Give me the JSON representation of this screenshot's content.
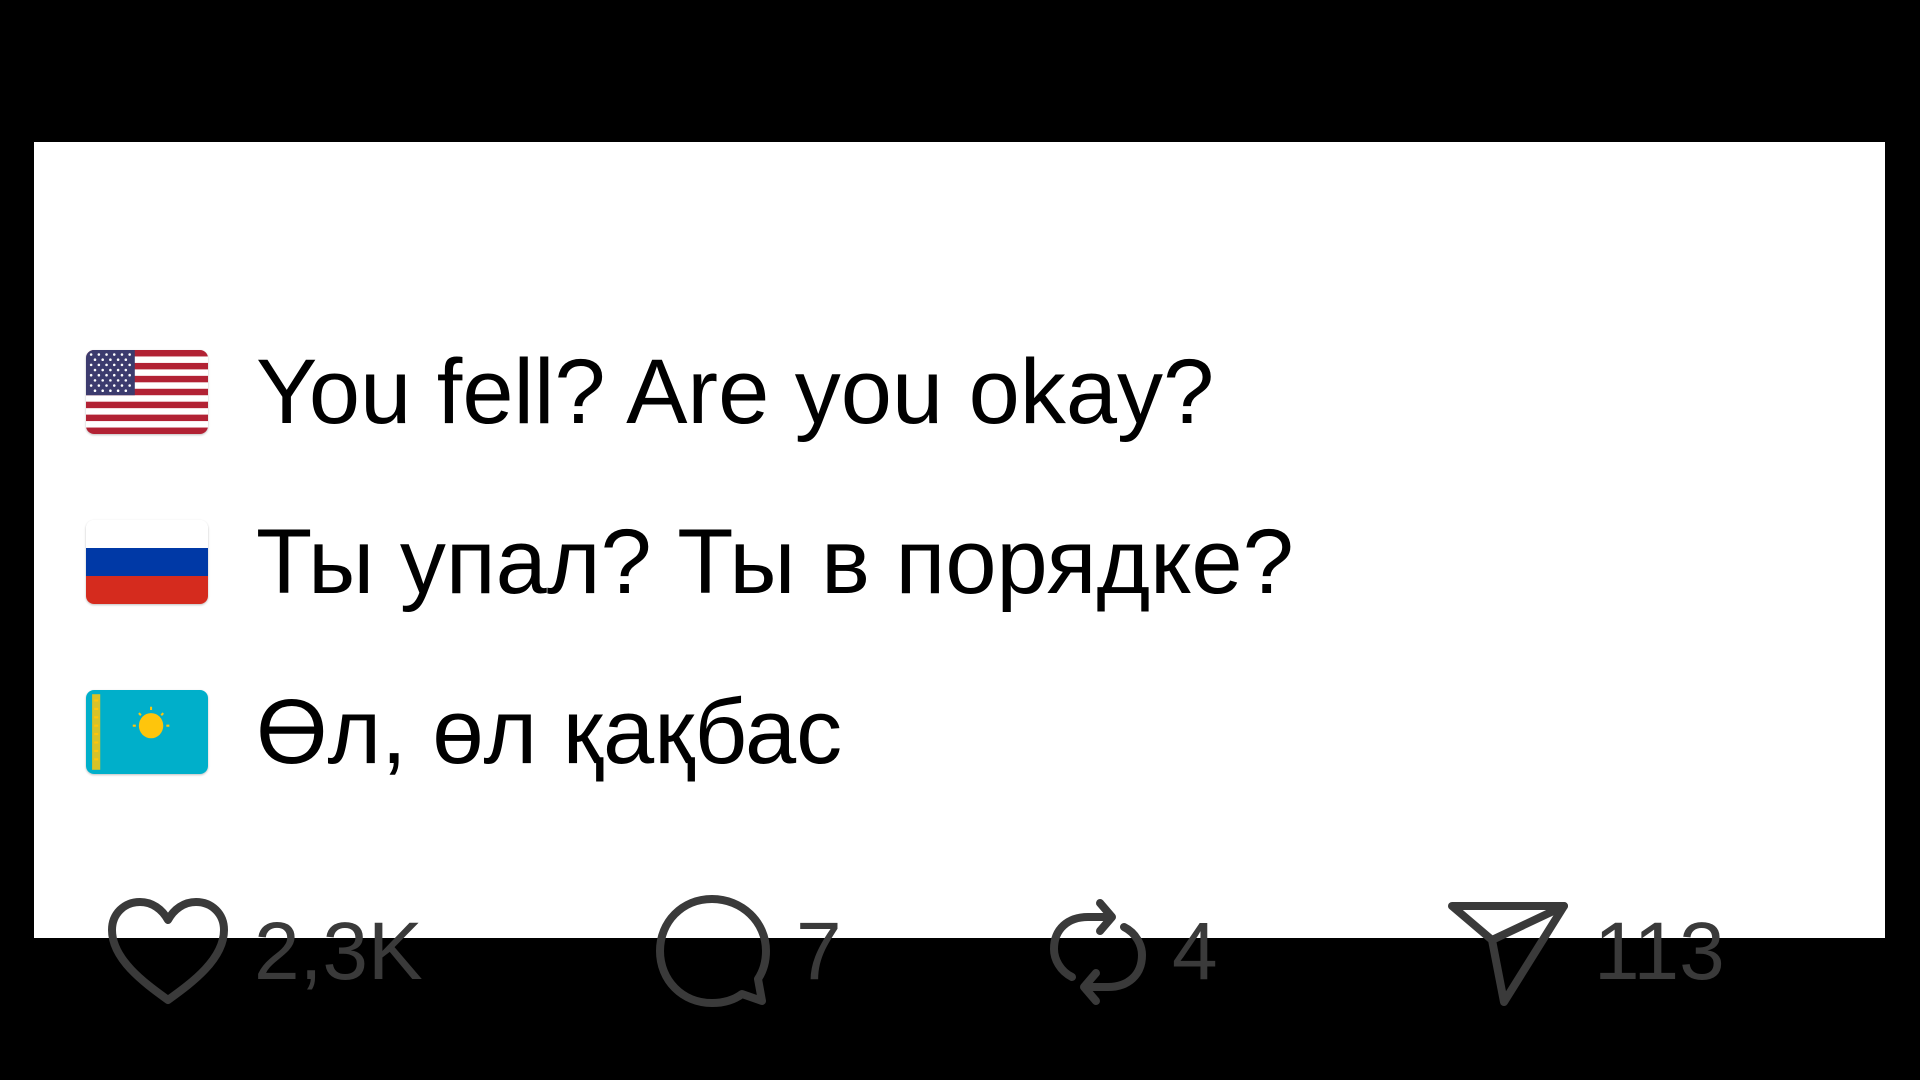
{
  "post": {
    "lines": [
      {
        "flag": "us-flag",
        "text": "You fell? Are you okay?"
      },
      {
        "flag": "ru-flag",
        "text": "Ты упал? Ты в порядке?"
      },
      {
        "flag": "kz-flag",
        "text": "Өл, өл қақбас"
      }
    ]
  },
  "actions": {
    "likes": "2,3K",
    "replies": "7",
    "reposts": "4",
    "shares": "113"
  },
  "colors": {
    "background": "#000000",
    "card": "#ffffff",
    "text": "#000000",
    "icon": "#3a3a3a",
    "kz_flag_blue": "#00AFCA",
    "kz_flag_gold": "#FEC50C",
    "us_flag_red": "#B22234",
    "us_flag_blue": "#3C3B6E",
    "ru_flag_blue": "#0039A6",
    "ru_flag_red": "#D52B1E"
  }
}
